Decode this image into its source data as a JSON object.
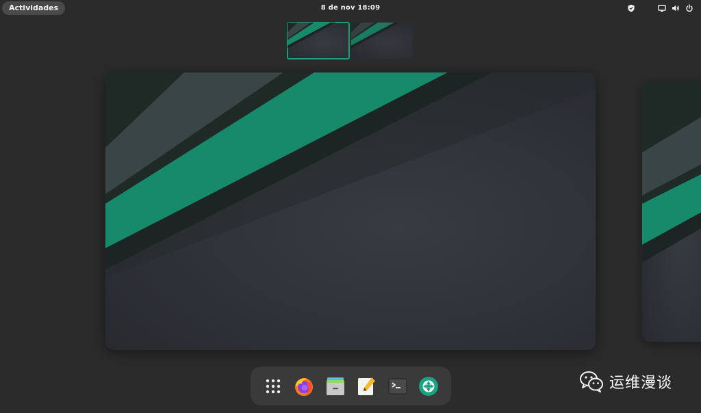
{
  "topbar": {
    "activities_label": "Actividades",
    "clock": "8 de nov  18:09",
    "tray_icons": [
      "shield-icon",
      "screen-icon",
      "volume-icon",
      "power-icon"
    ]
  },
  "workspaces": {
    "thumbnails": [
      "workspace-1",
      "workspace-2"
    ],
    "active_index": 0,
    "accent": "#1f9b78"
  },
  "wallpaper": {
    "teal": "#168a6b",
    "slate": "#3a4545",
    "dark": "#1f2a27",
    "base": "#31343b"
  },
  "dock": {
    "items": [
      "apps-grid-icon",
      "firefox-icon",
      "files-icon",
      "text-editor-icon",
      "terminal-icon",
      "screenshot-icon"
    ]
  },
  "watermark": {
    "text": "运维漫谈",
    "logo": "wechat-logo"
  }
}
